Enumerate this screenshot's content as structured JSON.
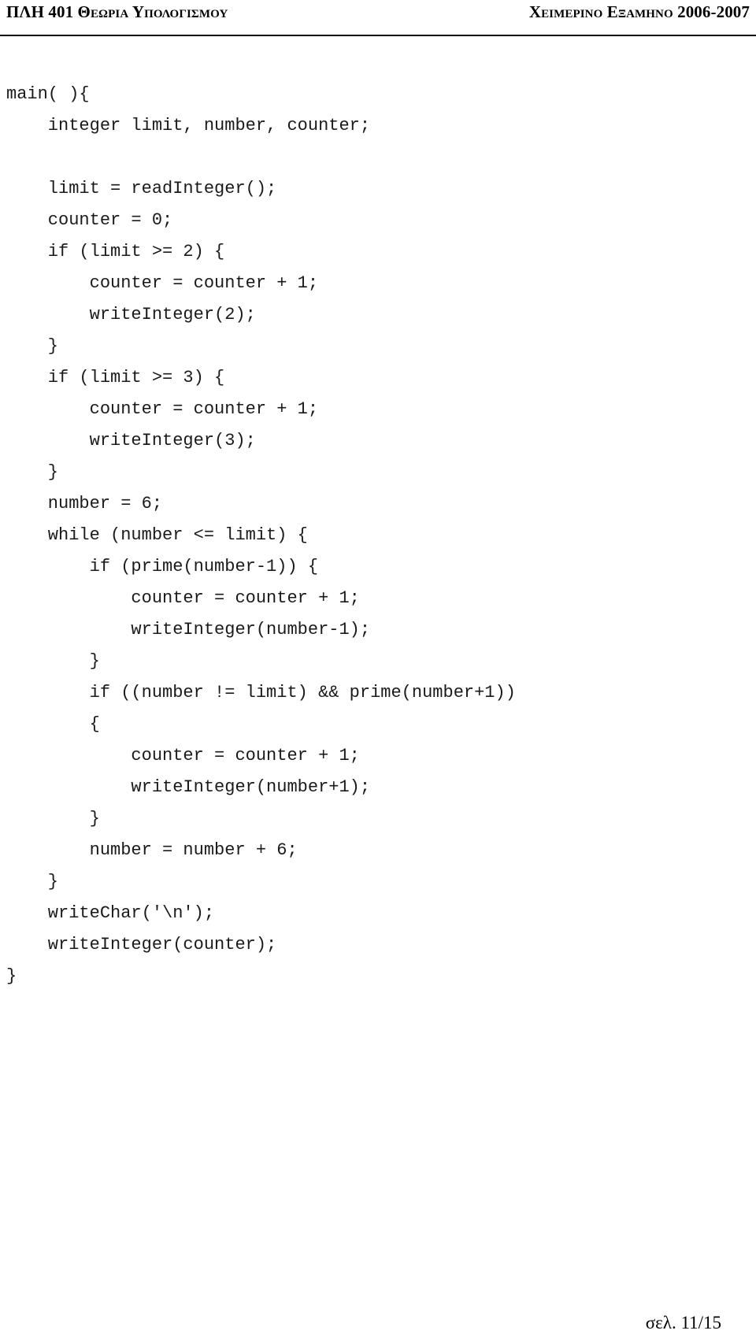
{
  "header": {
    "left": "ΠΛΗ 401 Θεωρια Υπολογισμου",
    "right": "Χειμερινο Εξαμηνο 2006-2007"
  },
  "code": {
    "language": "pseudocode",
    "lines": [
      "main( ){",
      "    integer limit, number, counter;",
      "",
      "    limit = readInteger();",
      "    counter = 0;",
      "    if (limit >= 2) {",
      "        counter = counter + 1;",
      "        writeInteger(2);",
      "    }",
      "    if (limit >= 3) {",
      "        counter = counter + 1;",
      "        writeInteger(3);",
      "    }",
      "    number = 6;",
      "    while (number <= limit) {",
      "        if (prime(number-1)) {",
      "            counter = counter + 1;",
      "            writeInteger(number-1);",
      "        }",
      "        if ((number != limit) && prime(number+1))",
      "        {",
      "            counter = counter + 1;",
      "            writeInteger(number+1);",
      "        }",
      "        number = number + 6;",
      "    }",
      "    writeChar('\\n');",
      "    writeInteger(counter);",
      "}"
    ]
  },
  "footer": {
    "page_label": "σελ. 11/15"
  }
}
